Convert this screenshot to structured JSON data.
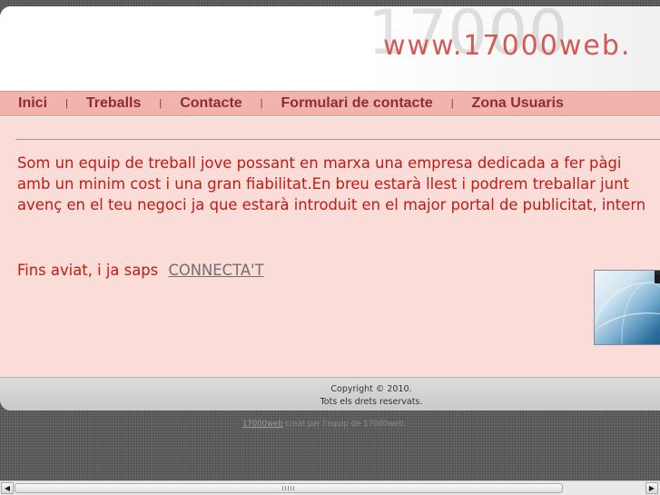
{
  "header": {
    "logo_text": "www.17000web.",
    "logo_bg_text": "17000"
  },
  "nav": {
    "items": [
      {
        "label": "Inici"
      },
      {
        "label": "Treballs"
      },
      {
        "label": "Contacte"
      },
      {
        "label": "Formulari de contacte"
      },
      {
        "label": "Zona Usuaris"
      }
    ],
    "separator": "|"
  },
  "content": {
    "intro_lines": [
      "Som un equip de treball jove possant en marxa una empresa dedicada a fer pàgi",
      "amb un minim cost i una gran fiabilitat.En breu estarà llest i podrem treballar junt",
      "avenç en el teu negoci ja que estarà introduit en el major portal de publicitat,  intern"
    ],
    "closing_text": "Fins aviat, i ja saps",
    "connect_link": "CONNECTA'T"
  },
  "footer": {
    "copyright_line1": "Copyright © 2010.",
    "copyright_line2": "Tots els drets reservats."
  },
  "credit": {
    "link_text": "17000web",
    "rest_text": " creat per l'equip de 17000web."
  },
  "scrollbar": {
    "left_arrow": "◀",
    "right_arrow": "▶"
  },
  "colors": {
    "accent_red": "#c41a12",
    "nav_bg": "#f2b3ae",
    "content_bg": "#fadcd9",
    "logo_red": "#d25a55"
  }
}
